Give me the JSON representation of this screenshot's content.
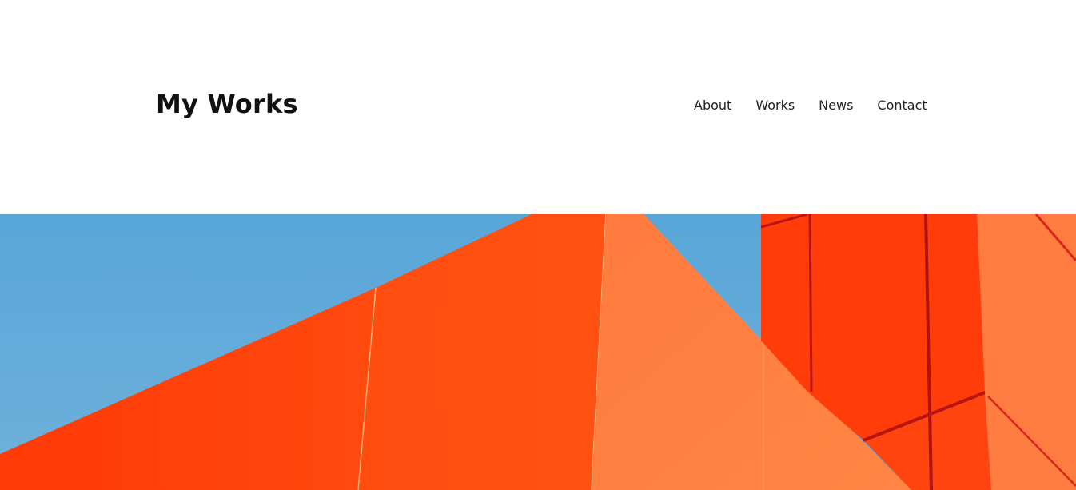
{
  "site": {
    "logo_text": "My Works"
  },
  "nav": {
    "items": [
      {
        "label": "About"
      },
      {
        "label": "Works"
      },
      {
        "label": "News"
      },
      {
        "label": "Contact"
      }
    ]
  },
  "hero": {
    "image": "orange-building-facade-against-blue-sky",
    "colors": {
      "sky": "#5ea8d8",
      "red_orange": "#ff3d0a",
      "orange": "#ff4e0e",
      "light_orange": "#ff7f40",
      "dark_red": "#c81a1a"
    }
  }
}
